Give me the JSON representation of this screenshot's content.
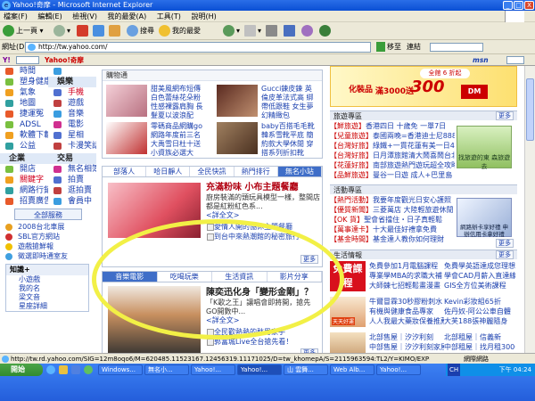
{
  "window": {
    "title": "Yahoo!奇摩 - Microsoft Internet Explorer",
    "min": "_",
    "max": "□",
    "close": "X"
  },
  "menu": [
    "檔案(F)",
    "編輯(E)",
    "檢視(V)",
    "我的最愛(A)",
    "工具(T)",
    "說明(H)"
  ],
  "toolbar": {
    "back": "上一頁",
    "search": "搜尋",
    "favorites": "我的最愛"
  },
  "address": {
    "label": "網址(D)",
    "url": "http://tw.yahoo.com/",
    "go": "移至",
    "links": "連結"
  },
  "linksbar": {
    "label": "Y!",
    "yahoo": "Yahoo!奇摩",
    "msn": "msn"
  },
  "left": {
    "grid1": [
      {
        "a": "時間",
        "b": ""
      },
      {
        "a": "塑身健康",
        "b": "娛樂",
        "bhd": true
      },
      {
        "a": "氣象",
        "b": "手機",
        "bred": true
      },
      {
        "a": "地圖",
        "b": "遊戲"
      },
      {
        "a": "捷運冤",
        "b": "音樂"
      },
      {
        "a": "ADSL",
        "b": "電影"
      },
      {
        "a": "軟體下載",
        "b": "星相"
      },
      {
        "a": "公益",
        "b": "卡漫笑話"
      }
    ],
    "grid2": [
      {
        "a": "企業",
        "b": "交易",
        "ahd": true,
        "bhd": true
      },
      {
        "a": "開店",
        "b": "無名相簿"
      },
      {
        "a": "關鍵字",
        "b": "拍賣",
        "ared": true
      },
      {
        "a": "網路行銷",
        "b": "逛拍賣"
      },
      {
        "a": "招賣廣告",
        "b": "會員中"
      }
    ],
    "all_button": "全部服務",
    "feeds": [
      "2008台北車展",
      "SBL官方網站",
      "遊戲搶鮮報",
      "徵選即時通室友"
    ],
    "kbox_title": "知識+",
    "kbox_rows": [
      "小遊戲",
      "我的名",
      "梁文音",
      "星座詳細"
    ]
  },
  "center": {
    "shop_title": "購物通",
    "products": [
      {
        "text": "甜美風網布短傳 白色蕾絲花朵粉 性感裸露肩胸 長髮夏以波浪配"
      },
      {
        "text": "Gucci鍊皮鍊 英倫皮革法式高 綁帶低跟鞋 女生夢幻精緻包"
      },
      {
        "text": "零碼商品網購go 網路年度前三名 大禹雪日杜十送 小資族必選大"
      },
      {
        "text": "baby百搭毛毛靴 韓系雪靴平底 簡約款大學休閒 穿搭系列折扣靴"
      }
    ],
    "tabs": [
      "部落人",
      "哈日靜人",
      "全民快訊",
      "熱門排行",
      "無名小站"
    ],
    "feature": {
      "title": "充滿粉味 小布主題餐廳",
      "text": "廚房裝滿的頭玩具模型一樣，整間店都是紅粉紅色系...",
      "more": "<詳全文>"
    },
    "feature_links": [
      "愛情人開的協休主題餐廳",
      "到台中來熱潮館的秘密旅行"
    ],
    "more": "更多",
    "tabs2": [
      "音樂電影",
      "吃喝玩樂",
      "生活資訊",
      "影片分享"
    ],
    "music": {
      "title": "陳奕迅化身「變形金剛」？",
      "text": "「K歌之王」讓唱會即將開，搶先GO開數中... ",
      "more": "<詳全文>"
    },
    "music_links": [
      "全民歡熱熱的愁男家手",
      "郭富城Live全台搶先看！"
    ]
  },
  "right": {
    "ad_top": {
      "brand": "化裝品",
      "slogan": "滿3000送",
      "big": "300",
      "unit": "DM",
      "badge": "全館 6 折起"
    },
    "travel_title": "旅遊專區",
    "travel_rows": [
      {
        "tag": "【鮮旅遊】",
        "text": "香港四日 十歲免 一單7日"
      },
      {
        "tag": "【兒童旅遊】",
        "text": "泰國兩晚=香港迪士尼8888"
      },
      {
        "tag": "【台灣好旅】",
        "text": "綠鐵+一貫花蓮有美一日498"
      },
      {
        "tag": "【台灣好旅】",
        "text": "日月潭旅館清大鬧喜鬧台北"
      },
      {
        "tag": "【花蓮好旅】",
        "text": "南部旅遊熱門遊玩超全攻略！"
      },
      {
        "tag": "【品鮮旅遊】",
        "text": "曼谷一日遊 成人+巴里島"
      }
    ],
    "travel_side": "找旅遊的東 森旅遊去",
    "event_title": "活動專區",
    "event_rows": [
      {
        "tag": "【熱門活動】",
        "text": "我要年度觀光日安心護照"
      },
      {
        "tag": "【優質新聞】",
        "text": "三菱萬店 大陸輕旅遊休閒"
      },
      {
        "tag": "【OK 貨】",
        "text": "聖會省擋住・日子真輕鬆"
      },
      {
        "tag": "【萬事達卡】",
        "text": "十大最佳好禮拿免費"
      },
      {
        "tag": "【基金時間】",
        "text": "基金達人教你如何理財"
      }
    ],
    "event_side": "網路辦卡享好禮 申辦信用卡拿好禮",
    "life_title": "生活情報",
    "life_ad": "免費課程",
    "life_rows": [
      {
        "a": "免費參加1月電腦課程",
        "b": "免費學英語達成您理想"
      },
      {
        "a": "專業學MBA的求職大補",
        "b": "學會CAD月薪入直達線"
      },
      {
        "a": "大師鍊七招輕鬆畫漫畫",
        "b": "GIS全方位美術課程"
      }
    ],
    "shop_rows": [
      {
        "a": "牛爾冒霖30秒膠粉刺水",
        "b": "Kevin彩妝組65折"
      },
      {
        "a": "有機與健康食品專家",
        "b": "佐丹奴-阿公公車自體"
      },
      {
        "a": "人人我最大藥妝保養推薦",
        "b": "大芙188張神麗隨身"
      }
    ],
    "beauty_badge": "天天好運",
    "home_rows": [
      {
        "a": "北部售屋｜汐汐利刻",
        "b": "北部租屋｜信義新"
      },
      {
        "a": "中部售屋｜汐汐利刻家屋",
        "b": "中部租屋｜找月租3000"
      },
      {
        "a": "南部售屋｜首北家",
        "b": "南部租屋｜台北..."
      }
    ],
    "more": "更多"
  },
  "status": {
    "text": "http://tw.rd.yahoo.com/SIG=12m8oqo6/M=620485.11523167.12456319.11171025/D=tw_khomepA/S=2115963594:TL2/Y=KIMO/EXP=1198396974/A=5",
    "zone": "網際網路"
  },
  "taskbar": {
    "start": "開始",
    "tasks": [
      "Windows...",
      "無名小...",
      "Yahoo!...",
      "Yahoo!...",
      "山 雲舞...",
      "Web Alb...",
      "Yahoo!..."
    ],
    "clock": "下午 04:24",
    "lang": "CH"
  }
}
